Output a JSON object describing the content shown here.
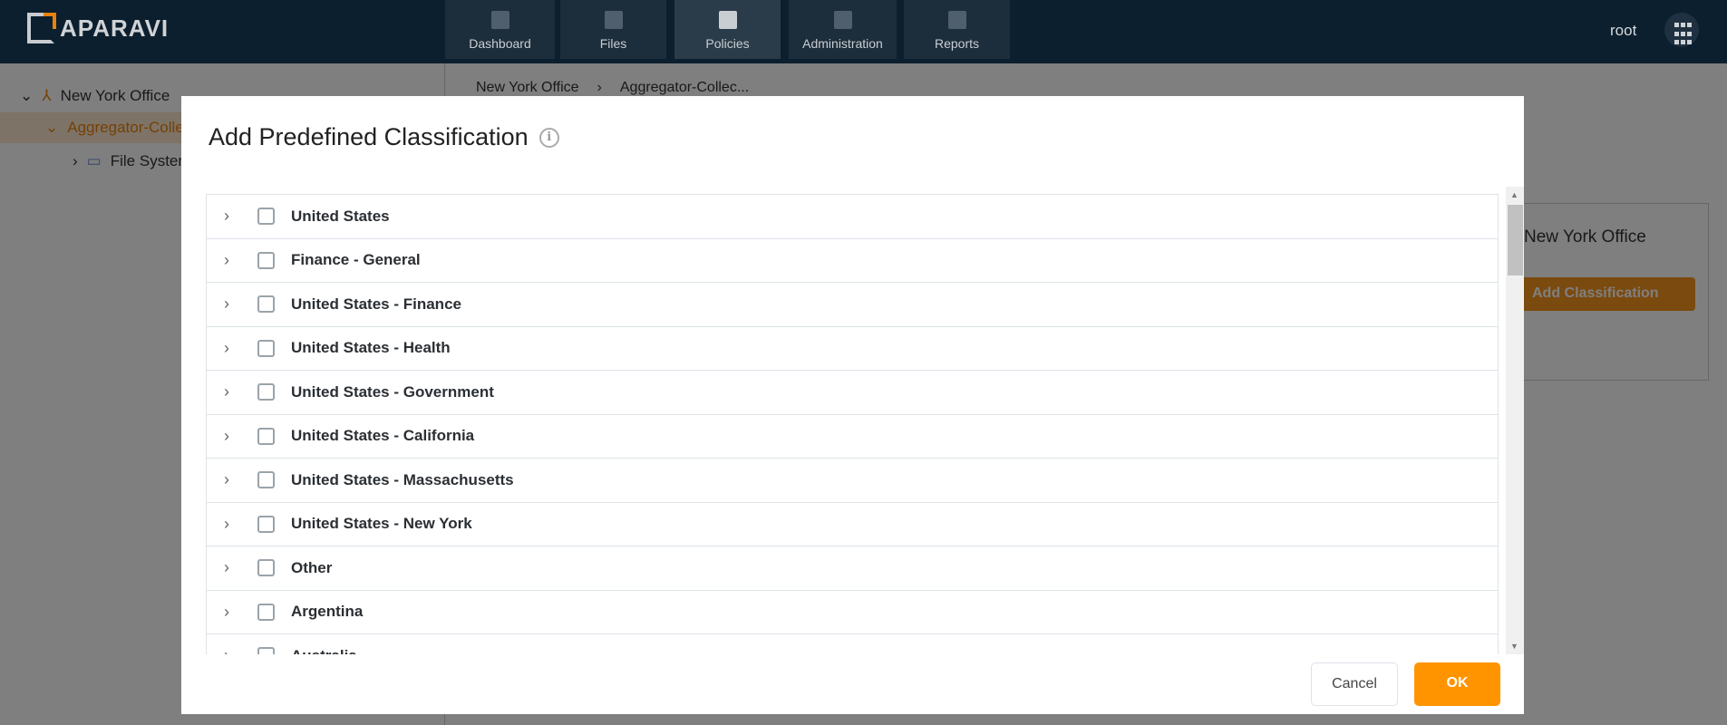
{
  "header": {
    "brand": "APARAVI",
    "user": "root",
    "nav": [
      {
        "label": "Dashboard",
        "icon": "dashboard-icon"
      },
      {
        "label": "Files",
        "icon": "folder-icon"
      },
      {
        "label": "Policies",
        "icon": "policies-icon",
        "active": true
      },
      {
        "label": "Administration",
        "icon": "users-icon"
      },
      {
        "label": "Reports",
        "icon": "clipboard-icon"
      }
    ]
  },
  "sidebar": {
    "items": [
      {
        "label": "New York Office"
      },
      {
        "label": "Aggregator-Collector"
      },
      {
        "label": "File System"
      }
    ]
  },
  "breadcrumb": [
    "New York Office",
    "Aggregator-Collec..."
  ],
  "background": {
    "panel_label": "New York Office",
    "add_button": "Add Classification"
  },
  "modal": {
    "title": "Add Predefined Classification",
    "items": [
      "United States",
      "Finance - General",
      "United States - Finance",
      "United States - Health",
      "United States - Government",
      "United States - California",
      "United States - Massachusetts",
      "United States - New York",
      "Other",
      "Argentina",
      "Australia"
    ],
    "cancel": "Cancel",
    "ok": "OK"
  },
  "colors": {
    "header": "#0c1f2e",
    "accent": "#ff9400"
  }
}
